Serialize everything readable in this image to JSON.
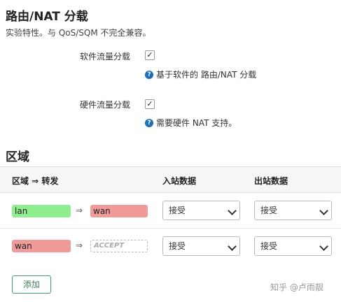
{
  "section_offload": {
    "title": "路由/NAT 分载",
    "description": "实验特性。与 QoS/SQM 不完全兼容。",
    "sw_label": "软件流量分载",
    "sw_checked": true,
    "sw_help": "基于软件的 路由/NAT 分载",
    "hw_label": "硬件流量分载",
    "hw_checked": true,
    "hw_help": "需要硬件 NAT 支持。",
    "help_icon_glyph": "?",
    "check_glyph": "✓"
  },
  "section_zones": {
    "title": "区域",
    "columns": [
      "区域 ⇒ 转发",
      "入站数据",
      "出站数据"
    ],
    "rows": [
      {
        "zone": "lan",
        "zone_color": "#90ee90",
        "arrow": "⇒",
        "forward": "wan",
        "forward_color": "#f09a9a",
        "input": "接受",
        "output": "接受"
      },
      {
        "zone": "wan",
        "zone_color": "#f09a9a",
        "arrow": "⇒",
        "forward": "ACCEPT",
        "forward_color": "",
        "input": "接受",
        "output": "接受"
      }
    ],
    "add_button": "添加"
  },
  "watermark": "知乎 @卢雨靓",
  "colors": {
    "lan": "#90ee90",
    "wan": "#f09a9a",
    "add_border": "#4a9c6c",
    "help_icon": "#1d6fb8"
  }
}
